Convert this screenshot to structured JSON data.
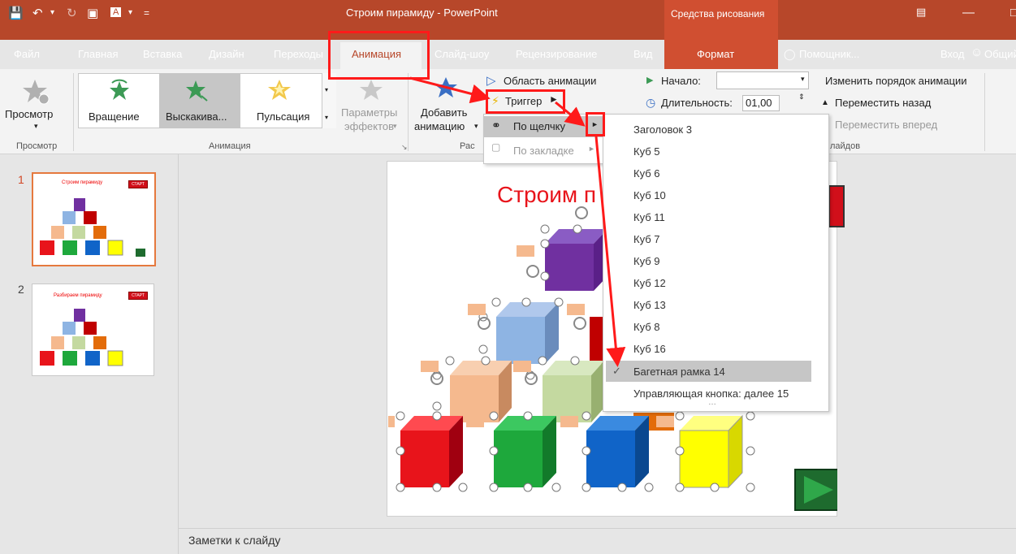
{
  "titlebar": {
    "title": "Строим пирамиду - PowerPoint",
    "drawing_tools": "Средства рисования"
  },
  "tabs": {
    "file": "Файл",
    "home": "Главная",
    "insert": "Вставка",
    "design": "Дизайн",
    "transitions": "Переходы",
    "animations": "Анимация",
    "slideshow": "Слайд-шоу",
    "review": "Рецензирование",
    "view": "Вид",
    "format": "Формат",
    "tell_me": "Помощник...",
    "signin": "Вход",
    "share": "Общий"
  },
  "ribbon": {
    "preview": "Просмотр",
    "preview_group": "Просмотр",
    "anim_rotate": "Вращение",
    "anim_popup": "Выскакива...",
    "anim_pulse": "Пульсация",
    "effect_options_1": "Параметры",
    "effect_options_2": "эффектов",
    "anim_group": "Анимация",
    "add_anim_1": "Добавить",
    "add_anim_2": "анимацию",
    "anim_pane": "Область анимации",
    "trigger": "Триггер",
    "ext_group": "Рас",
    "start_label": "Начало:",
    "duration_label": "Длительность:",
    "duration_value": "01,00",
    "reorder_label": "Изменить порядок анимации",
    "move_back": "Переместить назад",
    "move_forward": "Переместить вперед",
    "timing_group": "лайдов"
  },
  "trigger_menu": {
    "on_click": "По щелчку",
    "on_bookmark": "По закладке"
  },
  "shapes_list": [
    "Заголовок 3",
    "Куб 5",
    "Куб 6",
    "Куб 10",
    "Куб 11",
    "Куб 7",
    "Куб 9",
    "Куб 12",
    "Куб 13",
    "Куб 8",
    "Куб 16",
    "Багетная рамка 14",
    "Управляющая кнопка: далее 15"
  ],
  "thumbnails": {
    "slide1_num": "1",
    "slide1_title": "Строим пирамиду",
    "slide2_num": "2",
    "slide2_title": "Разбираем пирамиду",
    "start_badge": "СТАРТ"
  },
  "slide": {
    "title": "Строим п"
  },
  "notes": {
    "placeholder": "Заметки к слайду"
  },
  "colors": {
    "accent": "#b7472a",
    "cube_red": "#e8141b",
    "cube_green": "#1ea83c",
    "cube_blue": "#1064c8",
    "cube_yellow": "#ffff00",
    "cube_peach": "#f5b98e",
    "cube_lightblue": "#8eb4e3",
    "cube_lightgreen": "#c4d9a0",
    "cube_purple": "#7030a0",
    "cube_orange": "#e36c0a"
  }
}
